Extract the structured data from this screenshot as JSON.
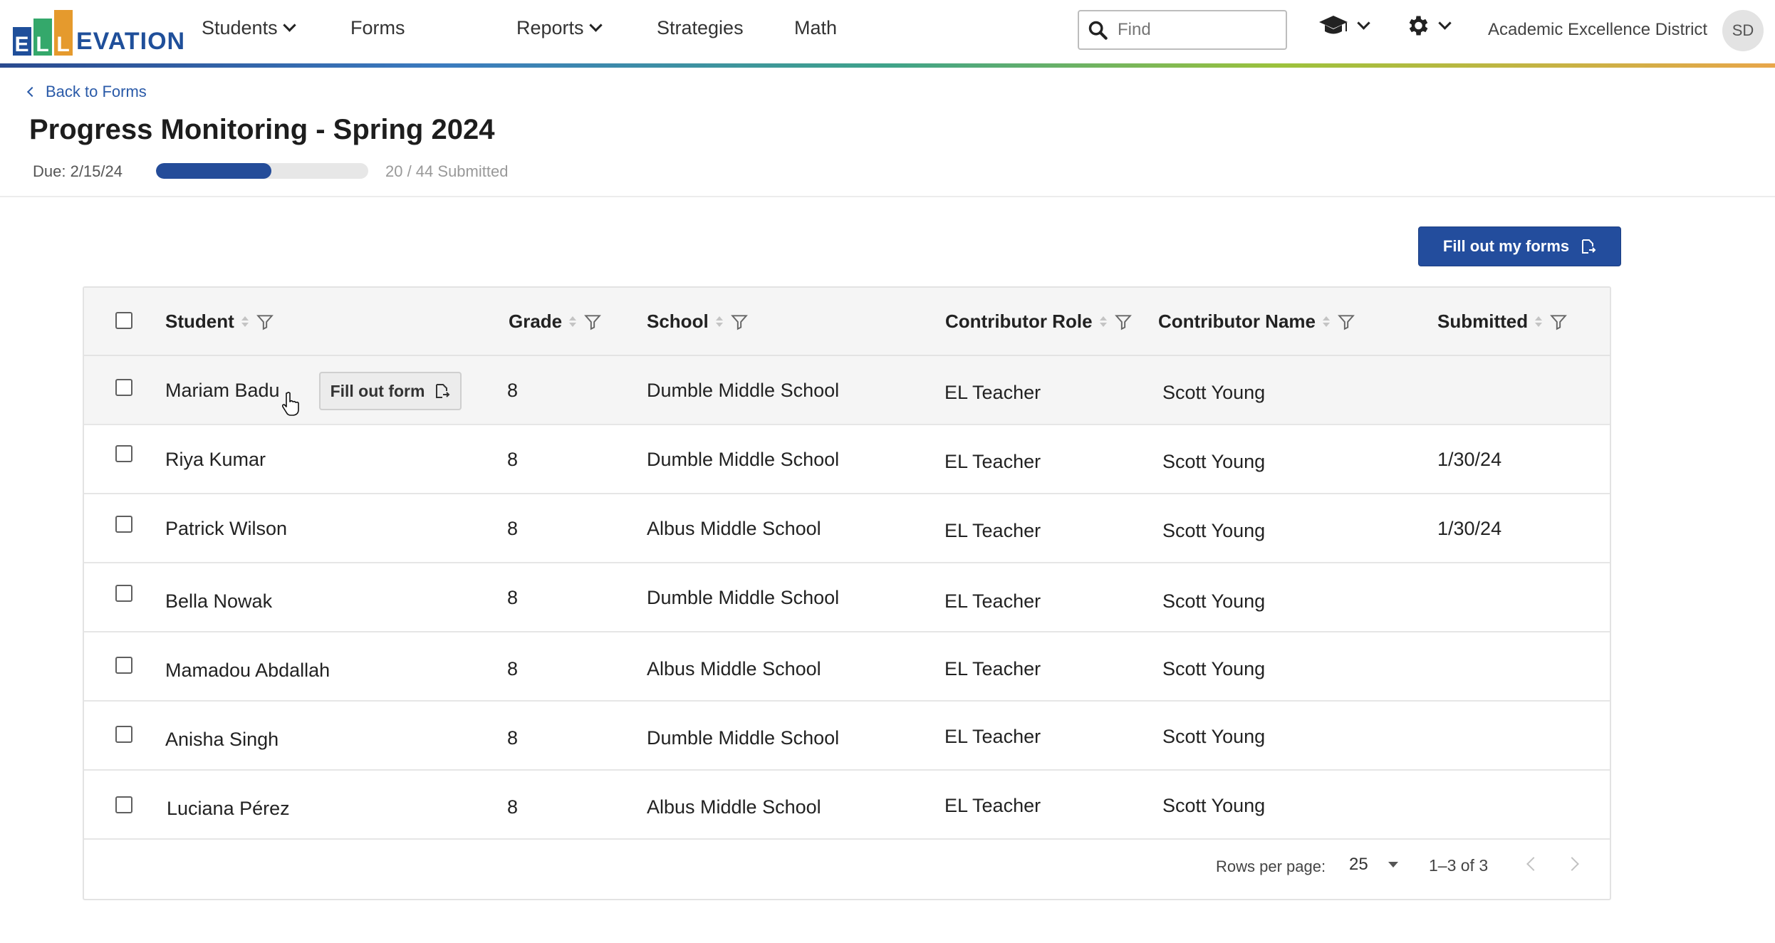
{
  "nav": {
    "logo": {
      "e": "E",
      "l1": "L",
      "l2": "L",
      "rest": "EVATION"
    },
    "links": {
      "students": "Students",
      "forms": "Forms",
      "reports": "Reports",
      "strategies": "Strategies",
      "math": "Math"
    },
    "search_placeholder": "Find",
    "district": "Academic Excellence District",
    "avatar_initials": "SD"
  },
  "header": {
    "back_label": "Back to Forms",
    "title": "Progress Monitoring - Spring 2024",
    "due": "Due: 2/15/24",
    "submitted_text": "20 / 44  Submitted",
    "progress_fraction": 0.545
  },
  "actions": {
    "fill_my_forms": "Fill out my forms",
    "row_fill_form": "Fill out form"
  },
  "table": {
    "columns": {
      "student": "Student",
      "grade": "Grade",
      "school": "School",
      "role": "Contributor Role",
      "name": "Contributor Name",
      "submitted": "Submitted"
    },
    "rows": [
      {
        "student": "Mariam Badu",
        "grade": "8",
        "school": "Dumble Middle School",
        "role": "EL Teacher",
        "name": "Scott Young",
        "submitted": ""
      },
      {
        "student": "Riya Kumar",
        "grade": "8",
        "school": "Dumble Middle School",
        "role": "EL Teacher",
        "name": "Scott Young",
        "submitted": "1/30/24"
      },
      {
        "student": "Patrick Wilson",
        "grade": "8",
        "school": "Albus Middle School",
        "role": "EL Teacher",
        "name": "Scott Young",
        "submitted": "1/30/24"
      },
      {
        "student": "Bella Nowak",
        "grade": "8",
        "school": "Dumble Middle School",
        "role": "EL Teacher",
        "name": "Scott Young",
        "submitted": ""
      },
      {
        "student": "Mamadou Abdallah",
        "grade": "8",
        "school": "Albus Middle School",
        "role": "EL Teacher",
        "name": "Scott Young",
        "submitted": ""
      },
      {
        "student": "Anisha Singh",
        "grade": "8",
        "school": "Dumble Middle School",
        "role": "EL Teacher",
        "name": "Scott Young",
        "submitted": ""
      },
      {
        "student": "Luciana Pérez",
        "grade": "8",
        "school": "Albus Middle School",
        "role": "EL Teacher",
        "name": "Scott Young",
        "submitted": ""
      }
    ],
    "footer": {
      "rows_per_page_label": "Rows per page:",
      "rows_per_page": "25",
      "range": "1–3 of 3"
    }
  },
  "colors": {
    "primary": "#234d9d",
    "link": "#2a5aa8",
    "progress_track": "#e7e7e7"
  }
}
